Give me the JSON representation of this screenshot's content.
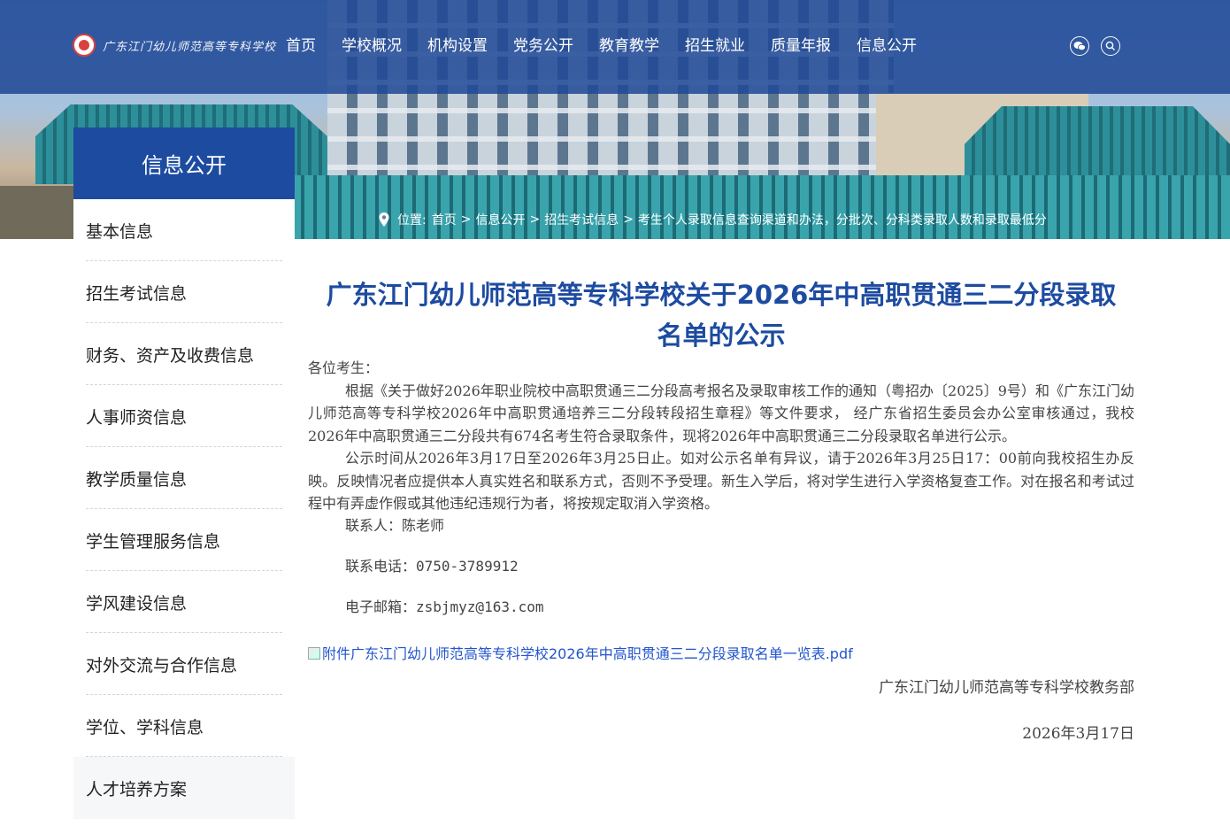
{
  "header": {
    "logo_text": "广东江门幼儿师范高等专科学校",
    "nav": [
      "首页",
      "学校概况",
      "机构设置",
      "党务公开",
      "教育教学",
      "招生就业",
      "质量年报",
      "信息公开"
    ],
    "icons": [
      "wechat-icon",
      "search-icon"
    ]
  },
  "breadcrumb": {
    "label": "位置:",
    "items": [
      "首页",
      "信息公开",
      "招生考试信息",
      "考生个人录取信息查询渠道和办法，分批次、分科类录取人数和录取最低分"
    ],
    "separator": ">"
  },
  "sidebar": {
    "heading": "信息公开",
    "items": [
      "基本信息",
      "招生考试信息",
      "财务、资产及收费信息",
      "人事师资信息",
      "教学质量信息",
      "学生管理服务信息",
      "学风建设信息",
      "对外交流与合作信息",
      "学位、学科信息",
      "人才培养方案"
    ]
  },
  "article": {
    "title_line1": "广东江门幼儿师范高等专科学校关于2026年中高职贯通三二分段录取",
    "title_line2": "名单的公示",
    "greeting": "各位考生：",
    "para1": "根据《关于做好2026年职业院校中高职贯通三二分段高考报名及录取审核工作的通知（粤招办〔2025〕9号）和《广东江门幼儿师范高等专科学校2026年中高职贯通培养三二分段转段招生章程》等文件要求， 经广东省招生委员会办公室审核通过，我校2026年中高职贯通三二分段共有674名考生符合录取条件，现将2026年中高职贯通三二分段录取名单进行公示。",
    "para2": "公示时间从2026年3月17日至2026年3月25日止。如对公示名单有异议，请于2026年3月25日17：00前向我校招生办反映。反映情况者应提供本人真实姓名和联系方式，否则不予受理。新生入学后，将对学生进行入学资格复查工作。对在报名和考试过程中有弄虚作假或其他违纪违规行为者，将按规定取消入学资格。",
    "contact_person": "联系人：陈老师",
    "contact_phone": "联系电话：0750-3789912",
    "contact_email": "电子邮箱：zsbjmyz@163.com",
    "attachment": "附件广东江门幼儿师范高等专科学校2026年中高职贯通三二分段录取名单一览表.pdf",
    "signature": "广东江门幼儿师范高等专科学校教务部",
    "date": "2026年3月17日"
  },
  "colors": {
    "primary": "#1d4ba0",
    "link": "#2255cc",
    "text": "#444444"
  }
}
